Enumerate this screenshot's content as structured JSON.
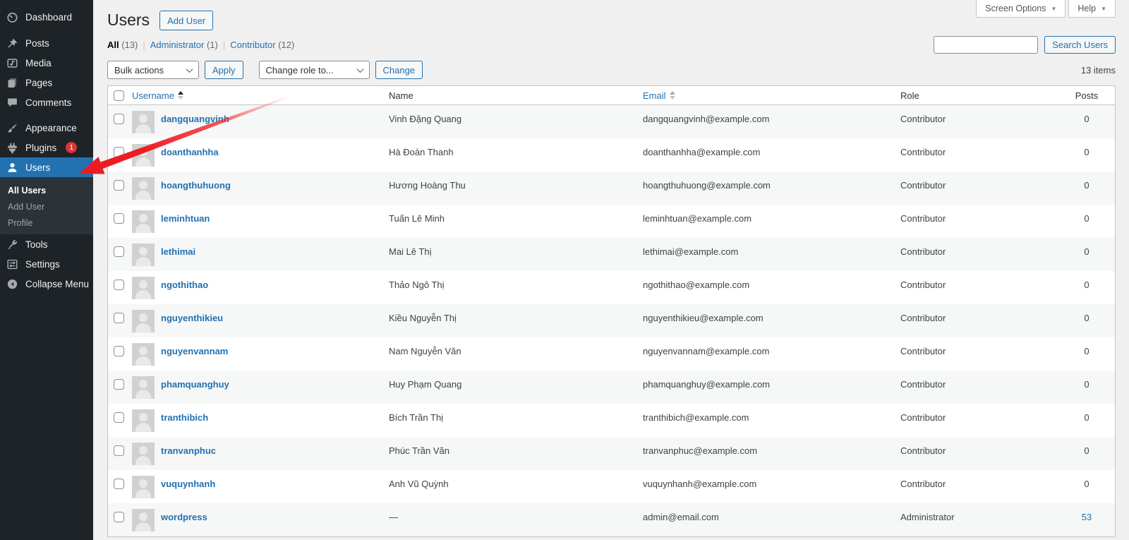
{
  "meta_links": {
    "screen_options": "Screen Options",
    "help": "Help",
    "caret": "▼"
  },
  "sidebar": {
    "items": [
      {
        "label": "Dashboard"
      },
      {
        "label": "Posts"
      },
      {
        "label": "Media"
      },
      {
        "label": "Pages"
      },
      {
        "label": "Comments"
      },
      {
        "label": "Appearance"
      },
      {
        "label": "Plugins",
        "badge": "1"
      },
      {
        "label": "Users"
      },
      {
        "label": "Tools"
      },
      {
        "label": "Settings"
      },
      {
        "label": "Collapse Menu"
      }
    ],
    "submenu": [
      {
        "label": "All Users",
        "current": true
      },
      {
        "label": "Add User"
      },
      {
        "label": "Profile"
      }
    ]
  },
  "page": {
    "title": "Users",
    "add_user_button": "Add User"
  },
  "views": [
    {
      "label": "All",
      "count": "(13)",
      "current": true
    },
    {
      "label": "Administrator",
      "count": "(1)"
    },
    {
      "label": "Contributor",
      "count": "(12)"
    }
  ],
  "toolbar": {
    "bulk_actions_selected": "Bulk actions",
    "apply_label": "Apply",
    "change_role_selected": "Change role to...",
    "change_label": "Change",
    "items_count": "13 items"
  },
  "search": {
    "value": "",
    "button_label": "Search Users"
  },
  "table": {
    "columns": {
      "username": "Username",
      "name": "Name",
      "email": "Email",
      "role": "Role",
      "posts": "Posts"
    },
    "rows": [
      {
        "username": "dangquangvinh",
        "name": "Vinh Đặng Quang",
        "email": "dangquangvinh@example.com",
        "role": "Contributor",
        "posts": "0"
      },
      {
        "username": "doanthanhha",
        "name": "Hà Đoàn Thanh",
        "email": "doanthanhha@example.com",
        "role": "Contributor",
        "posts": "0"
      },
      {
        "username": "hoangthuhuong",
        "name": "Hương Hoàng Thu",
        "email": "hoangthuhuong@example.com",
        "role": "Contributor",
        "posts": "0"
      },
      {
        "username": "leminhtuan",
        "name": "Tuấn Lê Minh",
        "email": "leminhtuan@example.com",
        "role": "Contributor",
        "posts": "0"
      },
      {
        "username": "lethimai",
        "name": "Mai Lê Thị",
        "email": "lethimai@example.com",
        "role": "Contributor",
        "posts": "0"
      },
      {
        "username": "ngothithao",
        "name": "Thảo Ngô Thị",
        "email": "ngothithao@example.com",
        "role": "Contributor",
        "posts": "0"
      },
      {
        "username": "nguyenthikieu",
        "name": "Kiều Nguyễn Thị",
        "email": "nguyenthikieu@example.com",
        "role": "Contributor",
        "posts": "0"
      },
      {
        "username": "nguyenvannam",
        "name": "Nam Nguyễn Văn",
        "email": "nguyenvannam@example.com",
        "role": "Contributor",
        "posts": "0"
      },
      {
        "username": "phamquanghuy",
        "name": "Huy Phạm Quang",
        "email": "phamquanghuy@example.com",
        "role": "Contributor",
        "posts": "0"
      },
      {
        "username": "tranthibich",
        "name": "Bích Trần Thị",
        "email": "tranthibich@example.com",
        "role": "Contributor",
        "posts": "0"
      },
      {
        "username": "tranvanphuc",
        "name": "Phúc Trần Văn",
        "email": "tranvanphuc@example.com",
        "role": "Contributor",
        "posts": "0"
      },
      {
        "username": "vuquynhanh",
        "name": "Anh Vũ Quỳnh",
        "email": "vuquynhanh@example.com",
        "role": "Contributor",
        "posts": "0"
      },
      {
        "username": "wordpress",
        "name": "—",
        "email": "admin@email.com",
        "role": "Administrator",
        "posts": "53",
        "posts_is_link": true
      }
    ]
  },
  "colors": {
    "accent_blue": "#2271b1",
    "sidebar_bg": "#1d2327",
    "submenu_bg": "#2c3338",
    "badge_red": "#d63638",
    "arrow_red": "#ec1c24",
    "stripe": "#f6f7f7",
    "page_bg": "#f0f0f1"
  }
}
